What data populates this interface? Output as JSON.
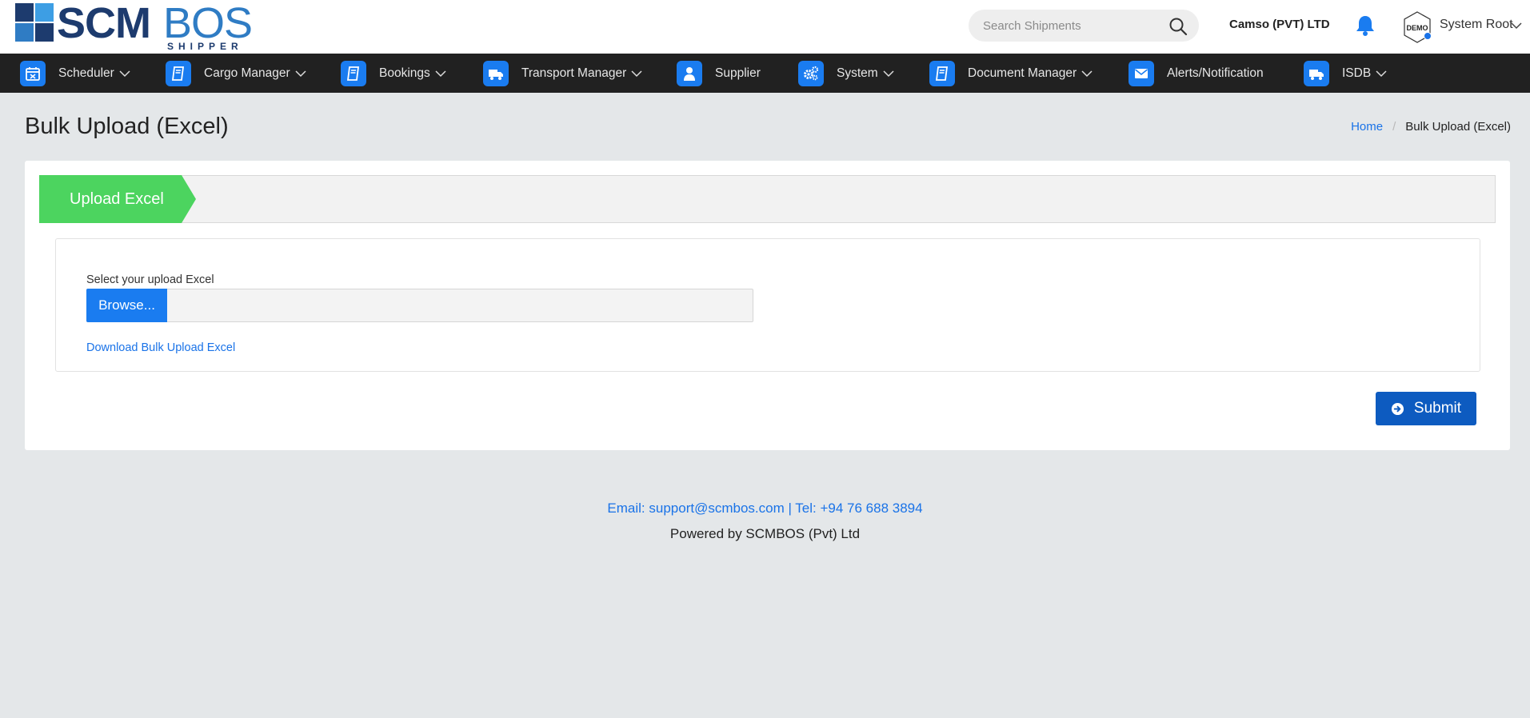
{
  "brand": {
    "logo_main": "SCM",
    "logo_accent": "BOS",
    "logo_sub": "SHIPPER"
  },
  "header": {
    "search_placeholder": "Search Shipments",
    "company": "Camso (PVT) LTD",
    "avatar_label": "DEMO",
    "user_name": "System Root"
  },
  "nav": {
    "items": [
      {
        "label": "Scheduler",
        "icon": "calendar-icon",
        "dropdown": true
      },
      {
        "label": "Cargo Manager",
        "icon": "book-icon",
        "dropdown": true
      },
      {
        "label": "Bookings",
        "icon": "book-icon",
        "dropdown": true
      },
      {
        "label": "Transport Manager",
        "icon": "truck-icon",
        "dropdown": true
      },
      {
        "label": "Supplier",
        "icon": "user-icon",
        "dropdown": false
      },
      {
        "label": "System",
        "icon": "gears-icon",
        "dropdown": true
      },
      {
        "label": "Document Manager",
        "icon": "book-icon",
        "dropdown": true
      },
      {
        "label": "Alerts/Notification",
        "icon": "envelope-icon",
        "dropdown": false
      },
      {
        "label": "ISDB",
        "icon": "truck-icon",
        "dropdown": true
      }
    ]
  },
  "page": {
    "title": "Bulk Upload (Excel)",
    "breadcrumb_home": "Home",
    "breadcrumb_current": "Bulk Upload (Excel)"
  },
  "form": {
    "step_label": "Upload Excel",
    "field_label": "Select your upload Excel",
    "browse_label": "Browse...",
    "download_link": "Download Bulk Upload Excel",
    "submit_label": "Submit"
  },
  "footer": {
    "contact": "Email: support@scmbos.com | Tel: +94 76 688 3894",
    "powered": "Powered by SCMBOS (Pvt) Ltd"
  },
  "colors": {
    "nav_bg": "#212121",
    "accent_blue": "#1a7cf0",
    "step_green": "#4cd45f",
    "submit_blue": "#0d5bc0"
  }
}
